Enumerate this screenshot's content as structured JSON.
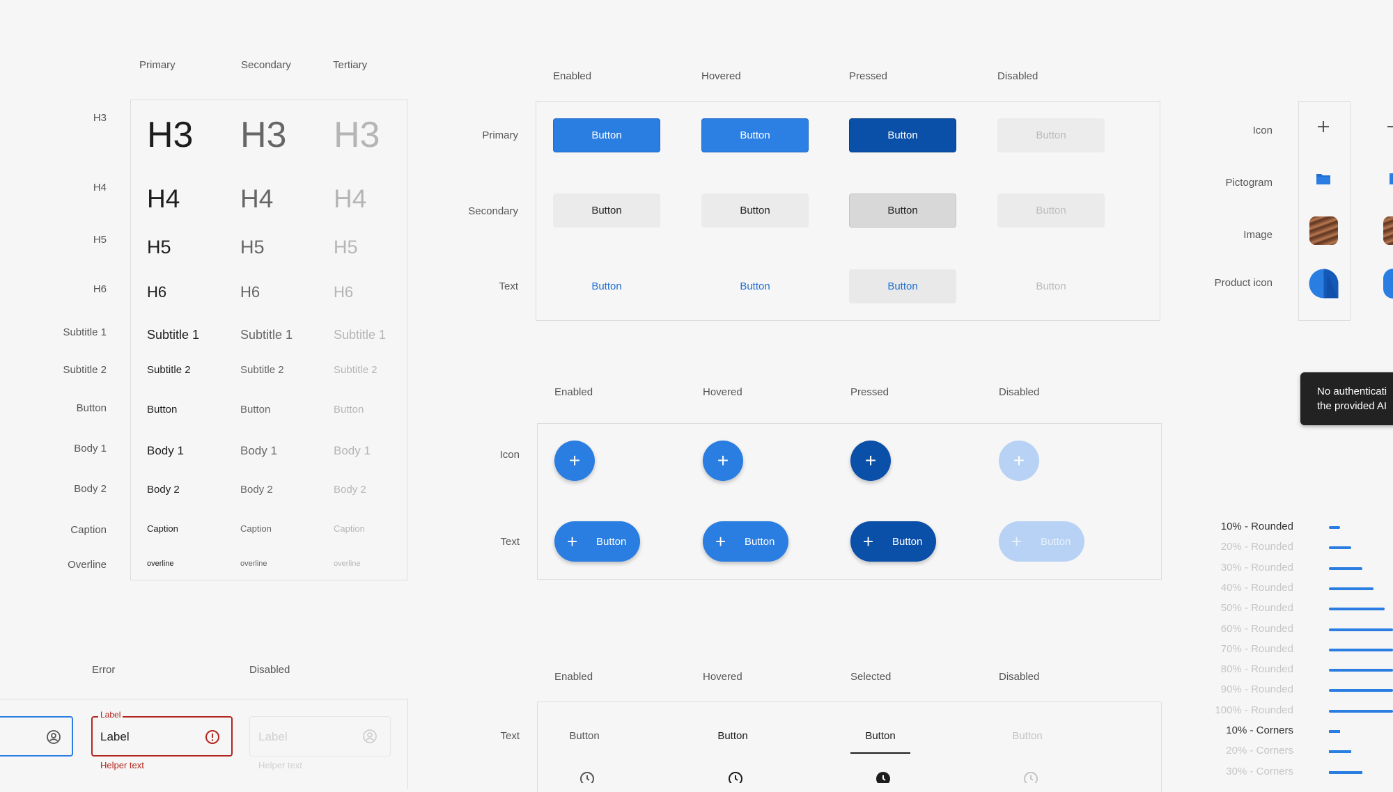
{
  "typography": {
    "columns": [
      "Primary",
      "Secondary",
      "Tertiary"
    ],
    "rows": [
      {
        "label": "H3",
        "sample": "H3"
      },
      {
        "label": "H4",
        "sample": "H4"
      },
      {
        "label": "H5",
        "sample": "H5"
      },
      {
        "label": "H6",
        "sample": "H6"
      },
      {
        "label": "Subtitle 1",
        "sample": "Subtitle 1"
      },
      {
        "label": "Subtitle 2",
        "sample": "Subtitle 2"
      },
      {
        "label": "Button",
        "sample": "Button"
      },
      {
        "label": "Body 1",
        "sample": "Body 1"
      },
      {
        "label": "Body 2",
        "sample": "Body 2"
      },
      {
        "label": "Caption",
        "sample": "Caption"
      },
      {
        "label": "Overline",
        "sample": "overline"
      }
    ]
  },
  "buttons": {
    "states": [
      "Enabled",
      "Hovered",
      "Pressed",
      "Disabled"
    ],
    "rows": [
      "Primary",
      "Secondary",
      "Text"
    ],
    "label": "Button"
  },
  "fabs": {
    "states": [
      "Enabled",
      "Hovered",
      "Pressed",
      "Disabled"
    ],
    "rows": [
      "Icon",
      "Text"
    ],
    "label": "Button",
    "icon": "+"
  },
  "tabs": {
    "states": [
      "Enabled",
      "Hovered",
      "Selected",
      "Disabled"
    ],
    "row": "Text",
    "label": "Button"
  },
  "fields": {
    "states": [
      "Error",
      "Disabled"
    ],
    "label": "Label",
    "value": "Label",
    "helper": "Helper text"
  },
  "icons": {
    "rows": [
      "Icon",
      "Pictogram",
      "Image",
      "Product icon"
    ]
  },
  "tooltip": {
    "line1": "No authenticati",
    "line2": "the provided AI"
  },
  "progress": [
    {
      "label": "10% - Rounded",
      "value": 0.1,
      "active": true
    },
    {
      "label": "20% - Rounded",
      "value": 0.2,
      "active": false
    },
    {
      "label": "30% - Rounded",
      "value": 0.3,
      "active": false
    },
    {
      "label": "40% - Rounded",
      "value": 0.4,
      "active": false
    },
    {
      "label": "50% - Rounded",
      "value": 0.5,
      "active": false
    },
    {
      "label": "60% - Rounded",
      "value": 0.6,
      "active": false
    },
    {
      "label": "70% - Rounded",
      "value": 0.7,
      "active": false
    },
    {
      "label": "80% - Rounded",
      "value": 0.8,
      "active": false
    },
    {
      "label": "90% - Rounded",
      "value": 0.9,
      "active": false
    },
    {
      "label": "100% - Rounded",
      "value": 1.0,
      "active": false
    },
    {
      "label": "10% - Corners",
      "value": 0.1,
      "active": true
    },
    {
      "label": "20% - Corners",
      "value": 0.2,
      "active": false
    },
    {
      "label": "30% - Corners",
      "value": 0.3,
      "active": false
    }
  ],
  "colors": {
    "accent": "#2a7de1",
    "pressed": "#0a4fa8",
    "error": "#b3261e"
  }
}
